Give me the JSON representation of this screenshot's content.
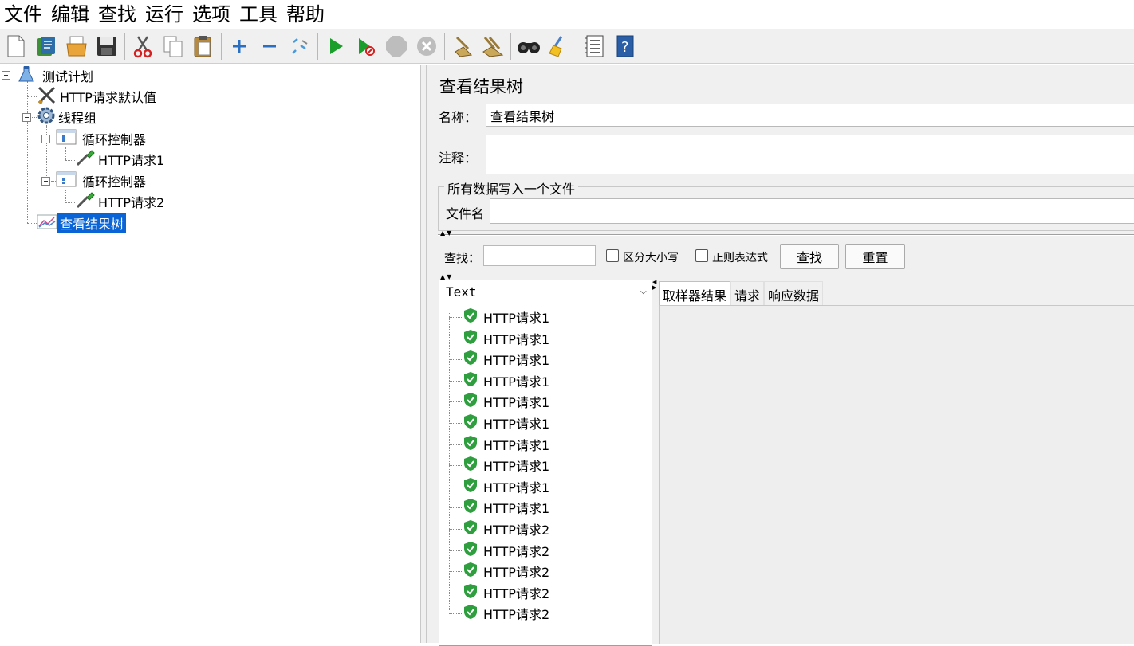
{
  "menu": [
    "文件",
    "编辑",
    "查找",
    "运行",
    "选项",
    "工具",
    "帮助"
  ],
  "toolbar": [
    "new-icon",
    "templates-icon",
    "open-icon",
    "save-icon",
    "cut-icon",
    "copy-icon",
    "paste-icon",
    "expand-icon",
    "collapse-icon",
    "toggle-icon",
    "start-icon",
    "start-no-pause-icon",
    "stop-icon",
    "shutdown-icon",
    "clear-icon",
    "clear-all-icon",
    "search-icon",
    "reset-search-icon",
    "function-helper-icon",
    "help-icon"
  ],
  "tree": {
    "test_plan": "测试计划",
    "http_defaults": "HTTP请求默认值",
    "thread_group": "线程组",
    "loop1": "循环控制器",
    "http1": "HTTP请求1",
    "loop2": "循环控制器",
    "http2": "HTTP请求2",
    "result_tree": "查看结果树"
  },
  "panel": {
    "title": "查看结果树",
    "name_label": "名称：",
    "name_value": "查看结果树",
    "comment_label": "注释：",
    "comment_value": "",
    "file_group_title": "所有数据写入一个文件",
    "filename_label": "文件名",
    "filename_value": ""
  },
  "search": {
    "label": "查找：",
    "value": "",
    "case_label": "区分大小写",
    "regex_label": "正则表达式",
    "find_button": "查找",
    "reset_button": "重置"
  },
  "results": {
    "renderer": "Text",
    "items": [
      "HTTP请求1",
      "HTTP请求1",
      "HTTP请求1",
      "HTTP请求1",
      "HTTP请求1",
      "HTTP请求1",
      "HTTP请求1",
      "HTTP请求1",
      "HTTP请求1",
      "HTTP请求1",
      "HTTP请求2",
      "HTTP请求2",
      "HTTP请求2",
      "HTTP请求2",
      "HTTP请求2"
    ],
    "status_color": "#2e9e3e",
    "tabs": [
      "取样器结果",
      "请求",
      "响应数据"
    ]
  },
  "colors": {
    "selection": "#0a64d6",
    "panel_bg": "#f0f0f0"
  }
}
